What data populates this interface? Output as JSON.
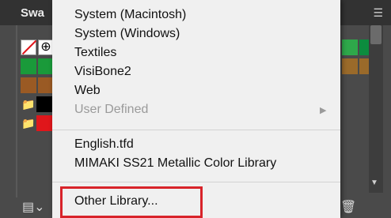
{
  "panel": {
    "tab_label": "Swa",
    "menu_icon": "panel-menu-icon",
    "swatch_colors": {
      "green": "#1a9a3a",
      "brown": "#9a5a24",
      "black": "#000000",
      "red": "#e0161b",
      "white": "#ffffff",
      "right_green_light": "#2ea84a",
      "right_green_dark": "#0c8c3e",
      "right_brown": "#9a6a2a"
    }
  },
  "menu": {
    "items": [
      {
        "label": "System (Macintosh)",
        "enabled": true
      },
      {
        "label": "System (Windows)",
        "enabled": true
      },
      {
        "label": "Textiles",
        "enabled": true
      },
      {
        "label": "VisiBone2",
        "enabled": true
      },
      {
        "label": "Web",
        "enabled": true
      },
      {
        "label": "User Defined",
        "enabled": false,
        "submenu": true
      }
    ],
    "custom_items": [
      {
        "label": "English.tfd"
      },
      {
        "label": "MIMAKI SS21 Metallic Color Library"
      }
    ],
    "other_library": {
      "label": "Other Library..."
    }
  }
}
